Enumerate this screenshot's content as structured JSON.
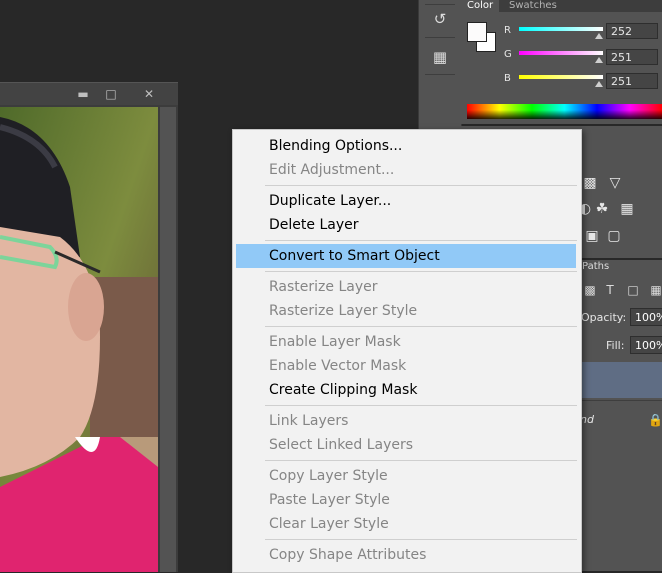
{
  "color_panel": {
    "tabs": [
      "Color",
      "Swatches"
    ],
    "active_tab": "Color",
    "channels": [
      {
        "label": "R",
        "value": "252",
        "gradient": [
          "#00ffff",
          "#ffffff"
        ]
      },
      {
        "label": "G",
        "value": "251",
        "gradient": [
          "#ff00ff",
          "#ffffff"
        ]
      },
      {
        "label": "B",
        "value": "251",
        "gradient": [
          "#ffff00",
          "#ffffff"
        ]
      }
    ],
    "foreground_color": "#fcfbfb",
    "background_color": "#ffffff"
  },
  "layers_panel": {
    "paths_tab": "Paths",
    "opacity_label": "Opacity:",
    "opacity_value": "100%",
    "fill_label": "Fill:",
    "fill_value": "100%",
    "layer_label_fragment": "nd"
  },
  "context_menu": {
    "items": [
      {
        "label": "Blending Options...",
        "enabled": true
      },
      {
        "label": "Edit Adjustment...",
        "enabled": false
      },
      {
        "label": "Duplicate Layer...",
        "enabled": true
      },
      {
        "label": "Delete Layer",
        "enabled": true
      },
      {
        "label": "Convert to Smart Object",
        "enabled": true,
        "highlighted": true
      },
      {
        "label": "Rasterize Layer",
        "enabled": false
      },
      {
        "label": "Rasterize Layer Style",
        "enabled": false
      },
      {
        "label": "Enable Layer Mask",
        "enabled": false
      },
      {
        "label": "Enable Vector Mask",
        "enabled": false
      },
      {
        "label": "Create Clipping Mask",
        "enabled": true
      },
      {
        "label": "Link Layers",
        "enabled": false
      },
      {
        "label": "Select Linked Layers",
        "enabled": false
      },
      {
        "label": "Copy Layer Style",
        "enabled": false
      },
      {
        "label": "Paste Layer Style",
        "enabled": false
      },
      {
        "label": "Clear Layer Style",
        "enabled": false
      },
      {
        "label": "Copy Shape Attributes",
        "enabled": false
      }
    ]
  },
  "icons": {
    "window_minimize": "minimize-icon",
    "window_maximize": "maximize-icon",
    "window_close": "close-icon",
    "lock": "lock-icon"
  },
  "colors": {
    "menu_highlight": "#91c9f7",
    "panel_bg": "#535353",
    "workspace_bg": "#282828"
  }
}
